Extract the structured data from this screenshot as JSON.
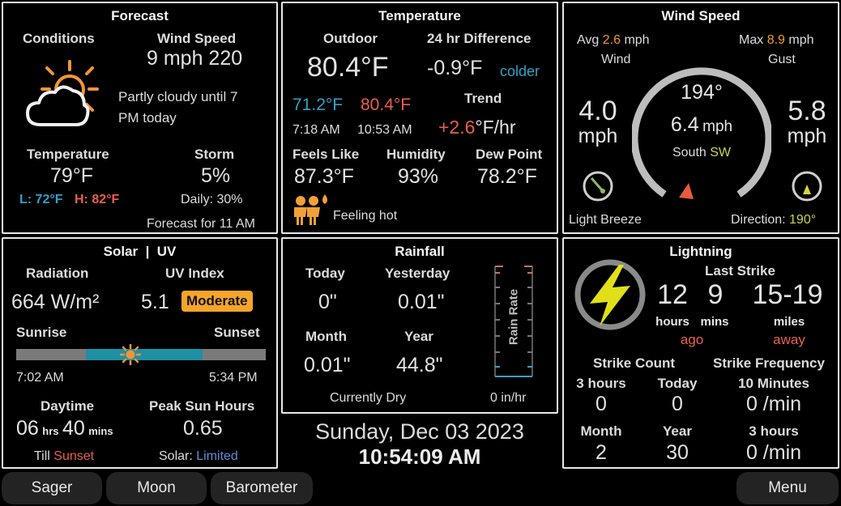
{
  "forecast": {
    "title": "Forecast",
    "conditions_label": "Conditions",
    "wind_label": "Wind Speed",
    "wind_value": "9 mph 220",
    "description_line1": "Partly cloudy until 7",
    "description_line2": "PM today",
    "temp_label": "Temperature",
    "temp_value": "79°F",
    "low": "L: 72°F",
    "high": "H: 82°F",
    "storm_label": "Storm",
    "storm_value": "5%",
    "daily": "Daily: 30%",
    "forecast_for": "Forecast for 11 AM",
    "icon": "partly-cloudy-icon"
  },
  "temperature": {
    "title": "Temperature",
    "outdoor_label": "Outdoor",
    "outdoor_value": "80.4°F",
    "diff_label": "24 hr Difference",
    "diff_value": "-0.9°F",
    "diff_word": "colder",
    "low_value": "71.2°F",
    "high_value": "80.4°F",
    "low_time": "7:18 AM",
    "high_time": "10:53 AM",
    "trend_label": "Trend",
    "trend_value": "+2.6",
    "trend_unit": "°F/hr",
    "feels_label": "Feels Like",
    "feels_value": "87.3°F",
    "humidity_label": "Humidity",
    "humidity_value": "93%",
    "dew_label": "Dew Point",
    "dew_value": "78.2°F",
    "feeling": "Feeling hot"
  },
  "wind": {
    "title": "Wind Speed",
    "avg_prefix": "Avg",
    "avg_value": "2.6",
    "avg_unit": "mph",
    "wind_label": "Wind",
    "max_prefix": "Max",
    "max_value": "8.9",
    "max_unit": "mph",
    "gust_label": "Gust",
    "left_value": "4.0",
    "left_unit": "mph",
    "right_value": "5.8",
    "right_unit": "mph",
    "direction_deg": "194°",
    "speed_value": "6.4",
    "speed_unit": "mph",
    "dir_word": "South",
    "dir_abbr": "SW",
    "breeze": "Light Breeze",
    "direction_label": "Direction:",
    "direction_value": "190°"
  },
  "solar": {
    "title": "Solar  |  UV",
    "radiation_label": "Radiation",
    "radiation_value": "664 W/m²",
    "uv_label": "UV Index",
    "uv_value": "5.1",
    "uv_badge": "Moderate",
    "sunrise_label": "Sunrise",
    "sunset_label": "Sunset",
    "sunrise_time": "7:02 AM",
    "sunset_time": "5:34 PM",
    "day_progress": 0.45,
    "daytime_label": "Daytime",
    "hours": "06",
    "hrs": "hrs",
    "mins": "40",
    "mins_unit": "mins",
    "till_prefix": "Till",
    "till_word": "Sunset",
    "peak_label": "Peak Sun Hours",
    "peak_value": "0.65",
    "solar_prefix": "Solar:",
    "solar_word": "Limited"
  },
  "rainfall": {
    "title": "Rainfall",
    "today_label": "Today",
    "today_value": "0\"",
    "yesterday_label": "Yesterday",
    "yesterday_value": "0.01\"",
    "month_label": "Month",
    "month_value": "0.01\"",
    "year_label": "Year",
    "year_value": "44.8\"",
    "status": "Currently Dry",
    "rate": "0 in/hr",
    "gauge_label": "Rain Rate"
  },
  "clock": {
    "date": "Sunday, Dec 03 2023",
    "time": "10:54:09 AM"
  },
  "lightning": {
    "title": "Lightning",
    "last_strike_label": "Last Strike",
    "hours_value": "12",
    "hours_label": "hours",
    "ago": "ago",
    "mins_value": "9",
    "mins_label": "mins",
    "miles_value": "15-19",
    "miles_label": "miles",
    "away": "away",
    "count_label": "Strike Count",
    "freq_label": "Strike Frequency",
    "c3h_label": "3 hours",
    "c3h_value": "0",
    "today_label": "Today",
    "today_value": "0",
    "f10_label": "10 Minutes",
    "f10_value": "0 /min",
    "month_label": "Month",
    "month_value": "2",
    "year_label": "Year",
    "year_value": "30",
    "f3h_label": "3 hours",
    "f3h_value": "0 /min"
  },
  "nav": {
    "sager": "Sager",
    "moon": "Moon",
    "barometer": "Barometer",
    "menu": "Menu"
  },
  "colors": {
    "accent_blue": "#2fa2c6",
    "accent_red": "#e8604a",
    "accent_orange": "#f09a2a",
    "accent_yellow": "#d0d34a",
    "badge": "#f4a52a"
  }
}
